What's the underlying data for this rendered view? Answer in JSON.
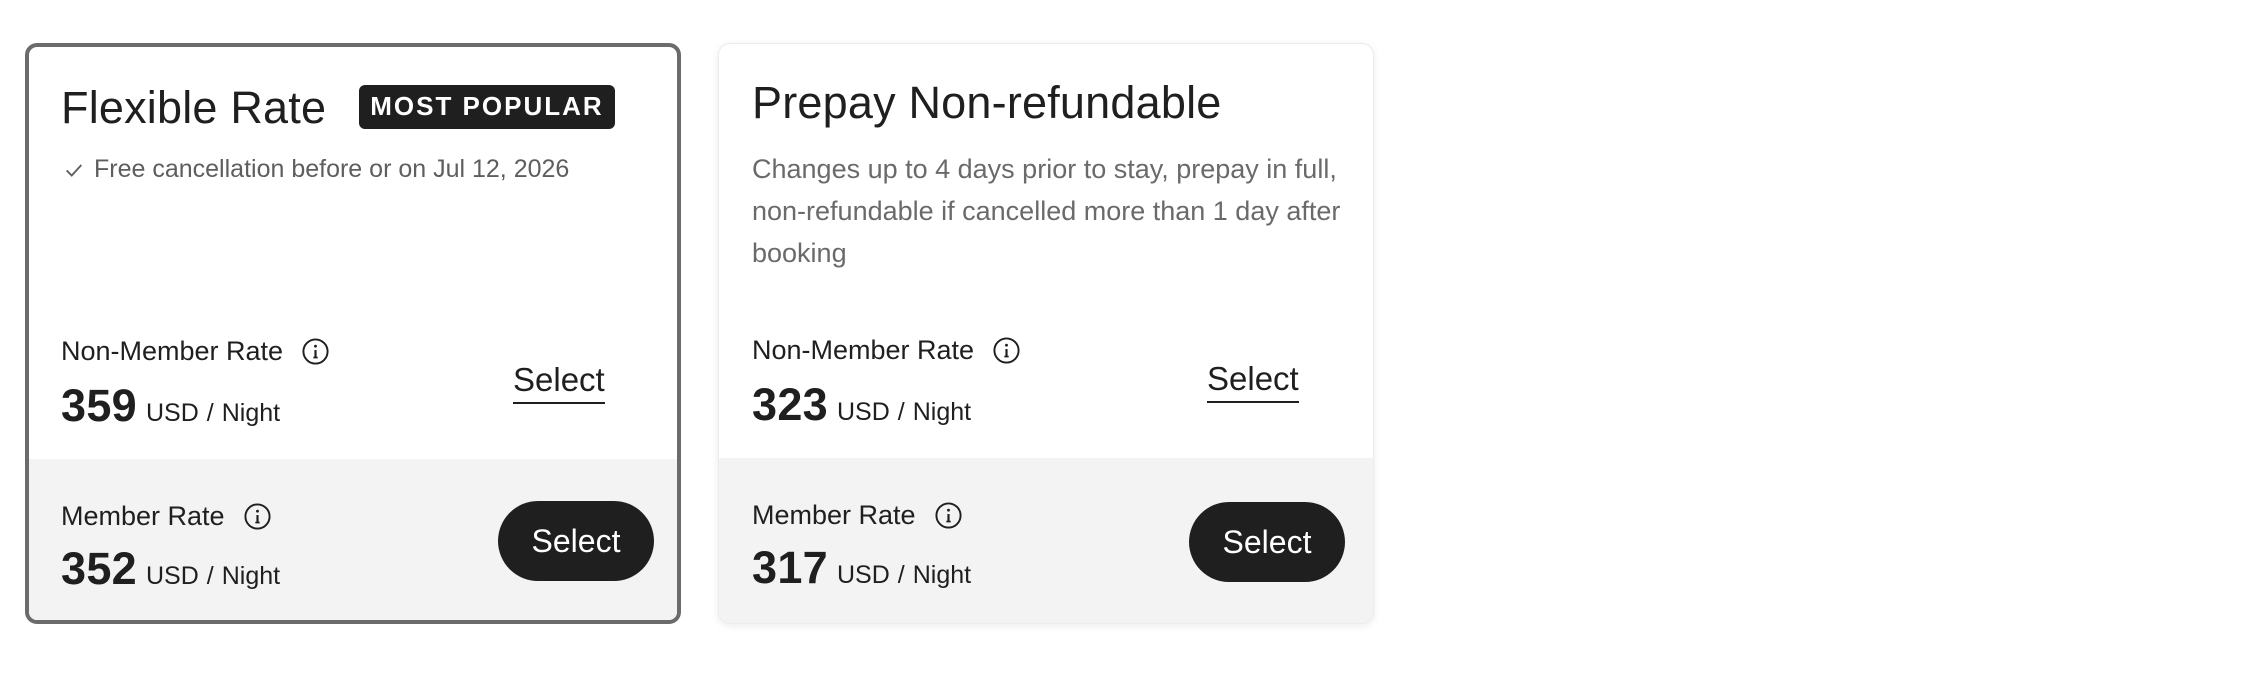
{
  "rates": [
    {
      "title": "Flexible Rate",
      "badge": "MOST POPULAR",
      "policy": "Free cancellation before or on Jul 12, 2026",
      "non_member": {
        "label": "Non-Member Rate",
        "price": "359",
        "currency": "USD",
        "slash": "/",
        "unit": "Night",
        "action": "Select"
      },
      "member": {
        "label": "Member Rate",
        "price": "352",
        "currency": "USD",
        "slash": "/",
        "unit": "Night",
        "action": "Select"
      }
    },
    {
      "title": "Prepay Non-refundable",
      "description": "Changes up to 4 days prior to stay, prepay in full, non-refundable if cancelled more than 1 day after booking",
      "non_member": {
        "label": "Non-Member Rate",
        "price": "323",
        "currency": "USD",
        "slash": "/",
        "unit": "Night",
        "action": "Select"
      },
      "member": {
        "label": "Member Rate",
        "price": "317",
        "currency": "USD",
        "slash": "/",
        "unit": "Night",
        "action": "Select"
      }
    }
  ],
  "icons": {
    "check": "checkmark-icon",
    "info": "info-icon"
  },
  "colors": {
    "primary": "#1f1f1f",
    "selected_border": "#6b6b6b",
    "member_bg": "#f3f3f3",
    "muted_text": "#6a6a6a"
  }
}
